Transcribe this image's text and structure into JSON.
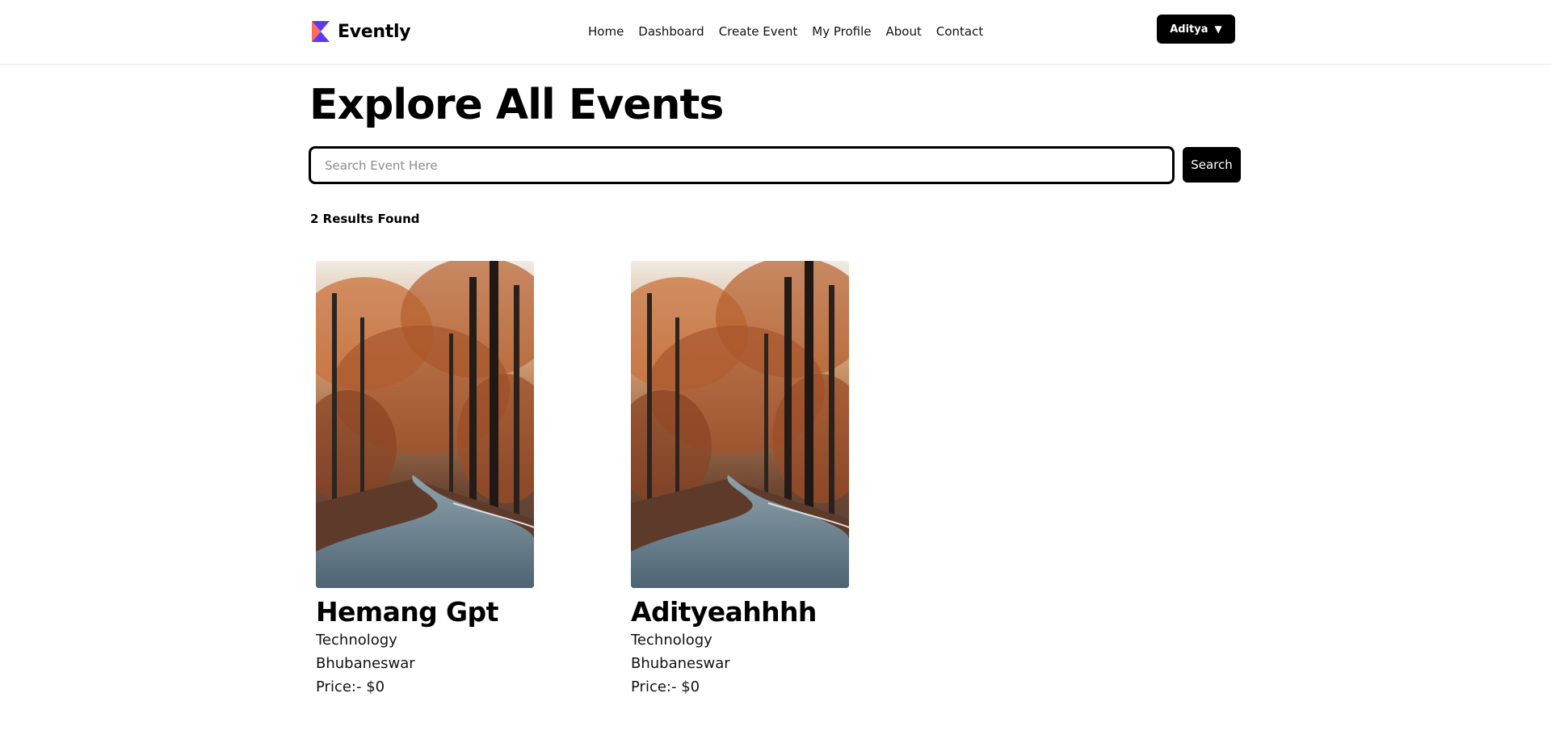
{
  "header": {
    "brand": {
      "name": "Evently",
      "logo_icon": "evently-logo-icon"
    },
    "nav": [
      {
        "label": "Home"
      },
      {
        "label": "Dashboard"
      },
      {
        "label": "Create Event"
      },
      {
        "label": "My Profile"
      },
      {
        "label": "About"
      },
      {
        "label": "Contact"
      }
    ],
    "user_menu": {
      "label": "Aditya",
      "caret": "▼",
      "icon": "chevron-down-icon"
    }
  },
  "main": {
    "title": "Explore All Events",
    "search": {
      "placeholder": "Search Event Here",
      "value": "",
      "button_label": "Search"
    },
    "results_label": "2 Results Found",
    "events": [
      {
        "title": "Hemang Gpt",
        "category": "Technology",
        "location": "Bhubaneswar",
        "price": "Price:- $0",
        "image": "autumn-forest-road-photo"
      },
      {
        "title": "Adityeahhhh",
        "category": "Technology",
        "location": "Bhubaneswar",
        "price": "Price:- $0",
        "image": "autumn-forest-road-photo"
      }
    ]
  },
  "colors": {
    "primary": "#000000",
    "logo_purple": "#5b3bf0",
    "logo_coral": "#ff6b5b",
    "border": "#e7e7e7"
  }
}
